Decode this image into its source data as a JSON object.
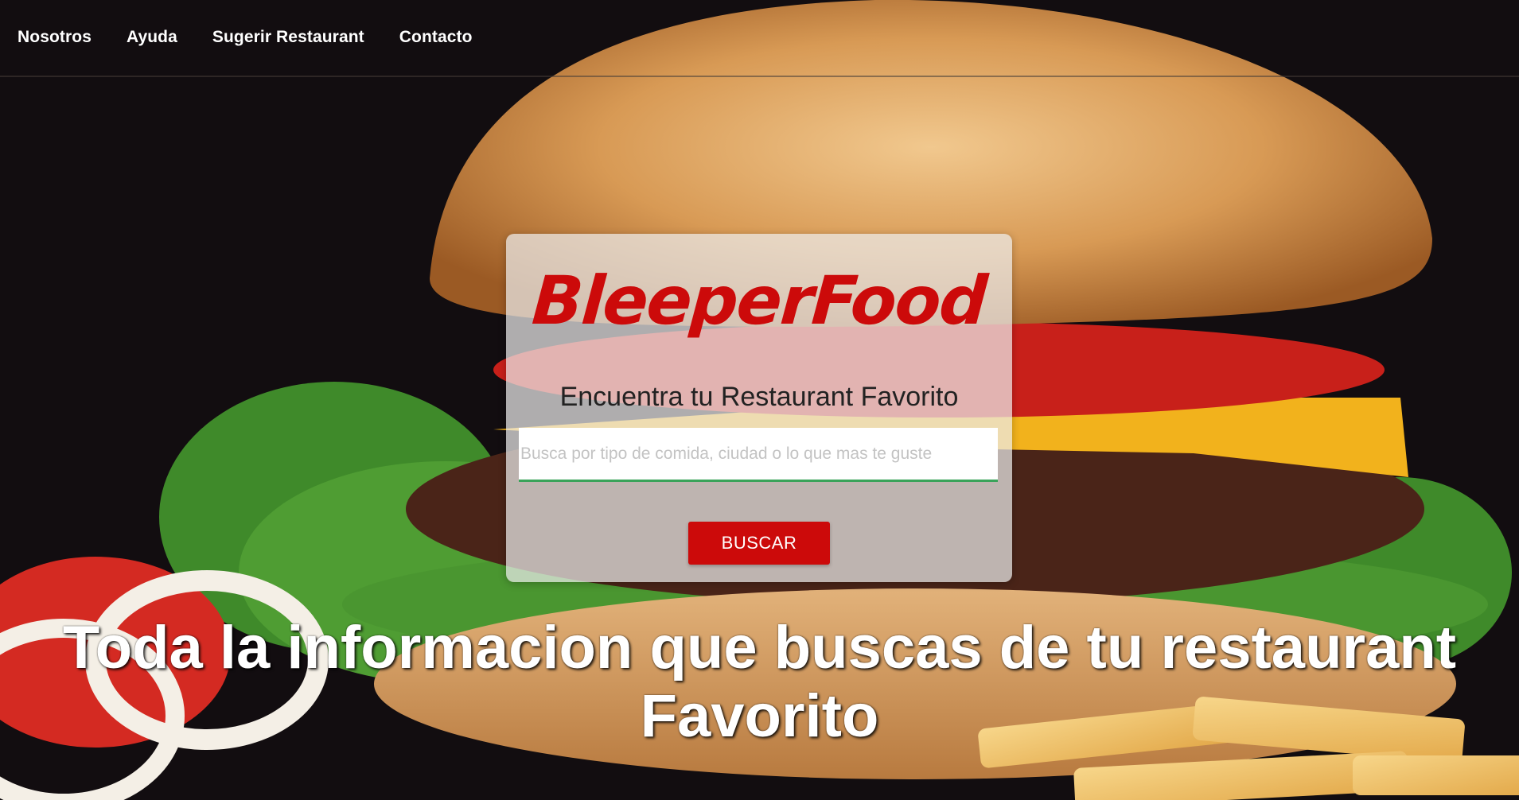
{
  "nav": {
    "items": [
      {
        "label": "Nosotros"
      },
      {
        "label": "Ayuda"
      },
      {
        "label": "Sugerir Restaurant"
      },
      {
        "label": "Contacto"
      }
    ]
  },
  "search_card": {
    "brand": "BleeperFood",
    "tagline": "Encuentra tu Restaurant Favorito",
    "search_placeholder": "Busca por tipo de comida, ciudad o lo que mas te guste",
    "search_value": "",
    "button_label": "BUSCAR"
  },
  "hero": {
    "headline_line1": "Toda la informacion que buscas de tu restaurant",
    "headline_line2": "Favorito"
  },
  "colors": {
    "brand_red": "#cc0a0a",
    "input_underline": "#3aa35a",
    "background_dark": "#120d10"
  }
}
